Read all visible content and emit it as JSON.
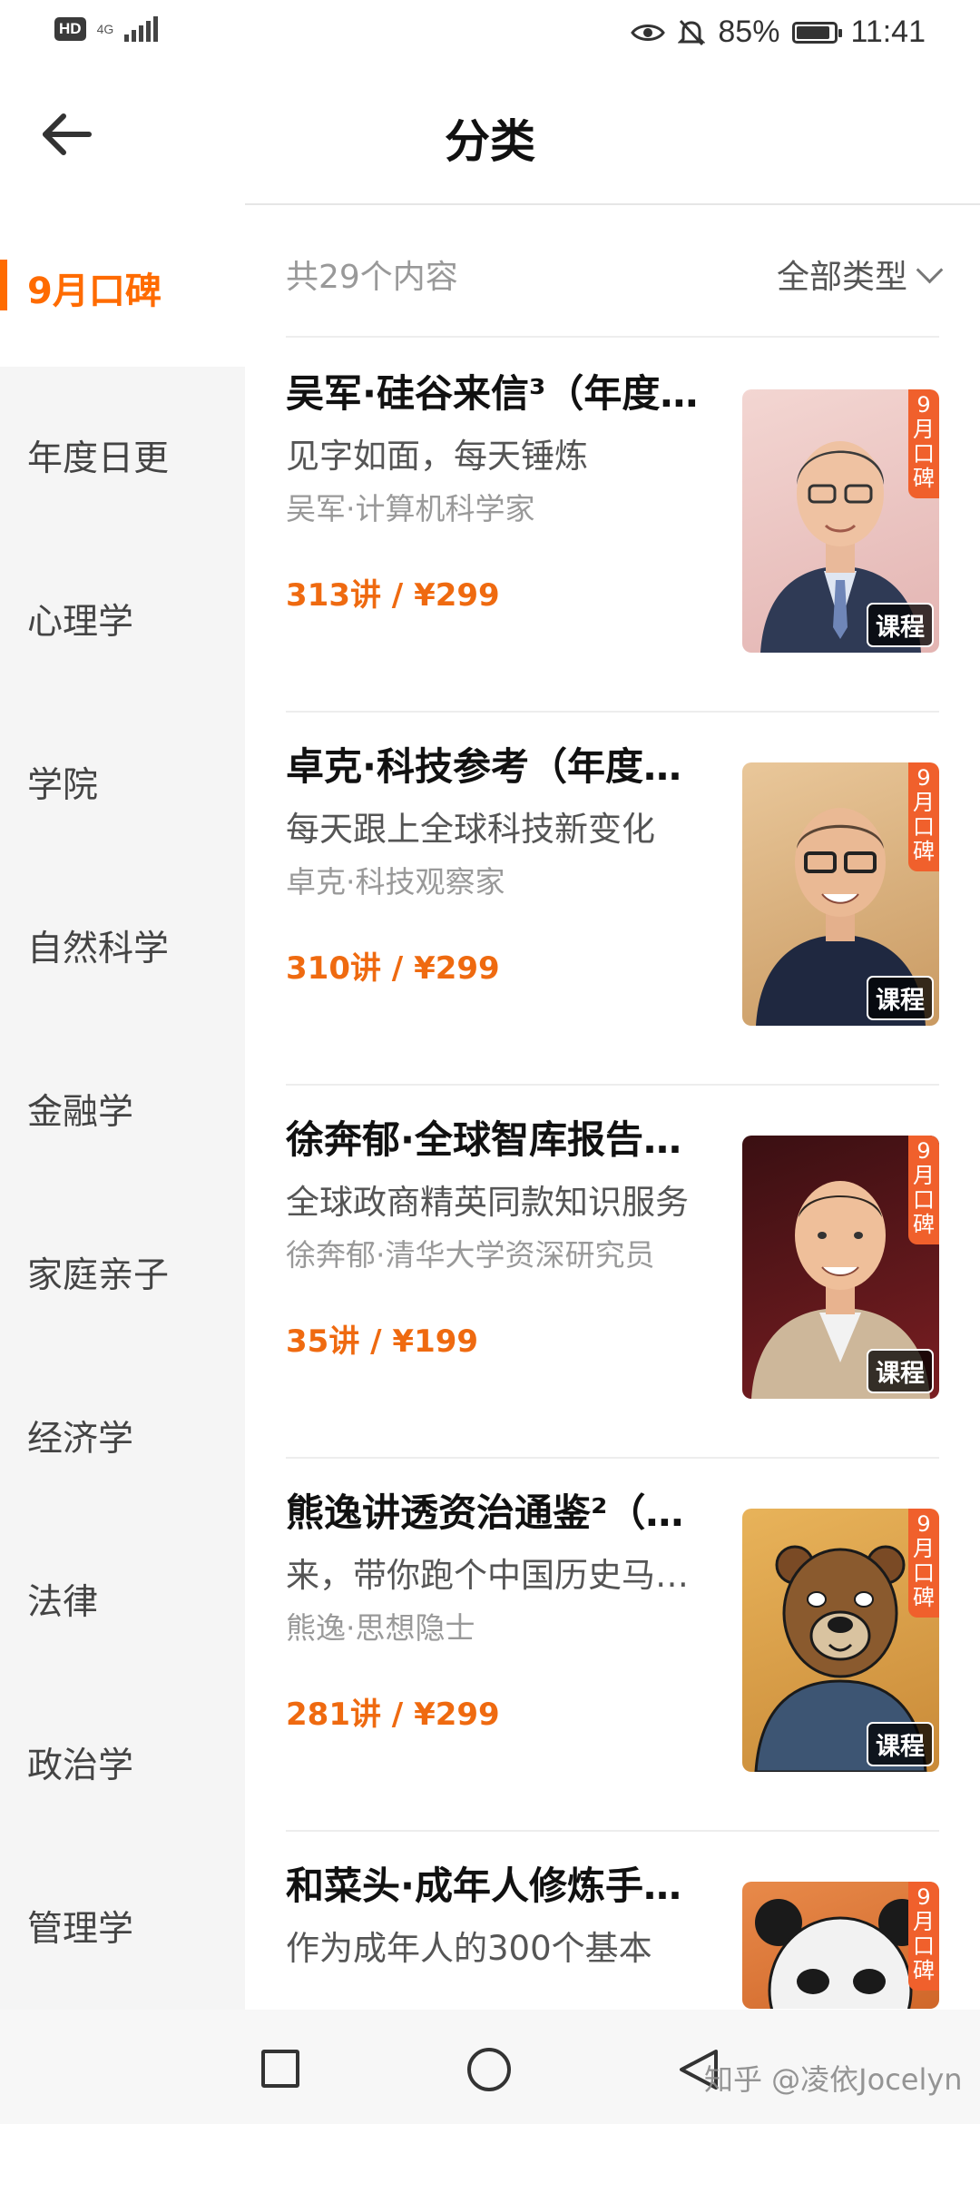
{
  "status_bar": {
    "hd": "HD",
    "network": "4G",
    "battery_percent": "85%",
    "time": "11:41"
  },
  "header": {
    "title": "分类"
  },
  "sidebar": {
    "active": "9月口碑",
    "items": [
      "年度日更",
      "心理学",
      "学院",
      "自然科学",
      "金融学",
      "家庭亲子",
      "经济学",
      "法律",
      "政治学",
      "管理学"
    ]
  },
  "filter": {
    "count": "共29个内容",
    "type_label": "全部类型"
  },
  "items": [
    {
      "title": "吴军·硅谷来信³（年度…",
      "subtitle": "见字如面，每天锤炼",
      "author": "吴军·计算机科学家",
      "price": "313讲 / ¥299",
      "badge": "9月口碑",
      "tag": "课程"
    },
    {
      "title": "卓克·科技参考（年度…",
      "subtitle": "每天跟上全球科技新变化",
      "author": "卓克·科技观察家",
      "price": "310讲 / ¥299",
      "badge": "9月口碑",
      "tag": "课程"
    },
    {
      "title": "徐奔郁·全球智库报告…",
      "subtitle": "全球政商精英同款知识服务",
      "author": "徐奔郁·清华大学资深研究员",
      "price": "35讲 / ¥199",
      "badge": "9月口碑",
      "tag": "课程"
    },
    {
      "title": "熊逸讲透资治通鉴²（…",
      "subtitle": "来，带你跑个中国历史马…",
      "author": "熊逸·思想隐士",
      "price": "281讲 / ¥299",
      "badge": "9月口碑",
      "tag": "课程"
    },
    {
      "title": "和菜头·成年人修炼手…",
      "subtitle": "作为成年人的300个基本",
      "author": "",
      "price": "",
      "badge": "9月口碑",
      "tag": ""
    }
  ],
  "watermark": "知乎 @凌依Jocelyn",
  "colors": {
    "accent": "#ff6b00",
    "price": "#ef6a10",
    "badge": "#f0602c"
  }
}
